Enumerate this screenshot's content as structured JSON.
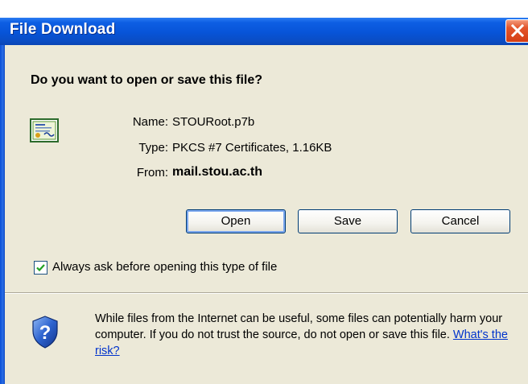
{
  "window": {
    "title": "File Download"
  },
  "dialog": {
    "question": "Do you want to open or save this file?",
    "file": {
      "name_label": "Name:",
      "name_value": "STOURoot.p7b",
      "type_label": "Type:",
      "type_value": "PKCS #7 Certificates, 1.16KB",
      "from_label": "From:",
      "from_value": "mail.stou.ac.th"
    },
    "buttons": {
      "open": "Open",
      "save": "Save",
      "cancel": "Cancel"
    },
    "checkbox": {
      "label": "Always ask before opening this type of file",
      "checked": true
    },
    "warning": {
      "text": "While files from the Internet can be useful, some files can potentially harm your computer. If you do not trust the source, do not open or save this file. ",
      "link_text": "What's the risk?"
    }
  },
  "icons": {
    "file": "certificate-icon",
    "close": "close-icon",
    "warning": "shield-question-icon",
    "check": "checkmark-icon"
  },
  "colors": {
    "titlebar": "#0754d8",
    "close_button": "#d43e13",
    "dialog_background": "#ece9d8",
    "link": "#0033cc"
  }
}
